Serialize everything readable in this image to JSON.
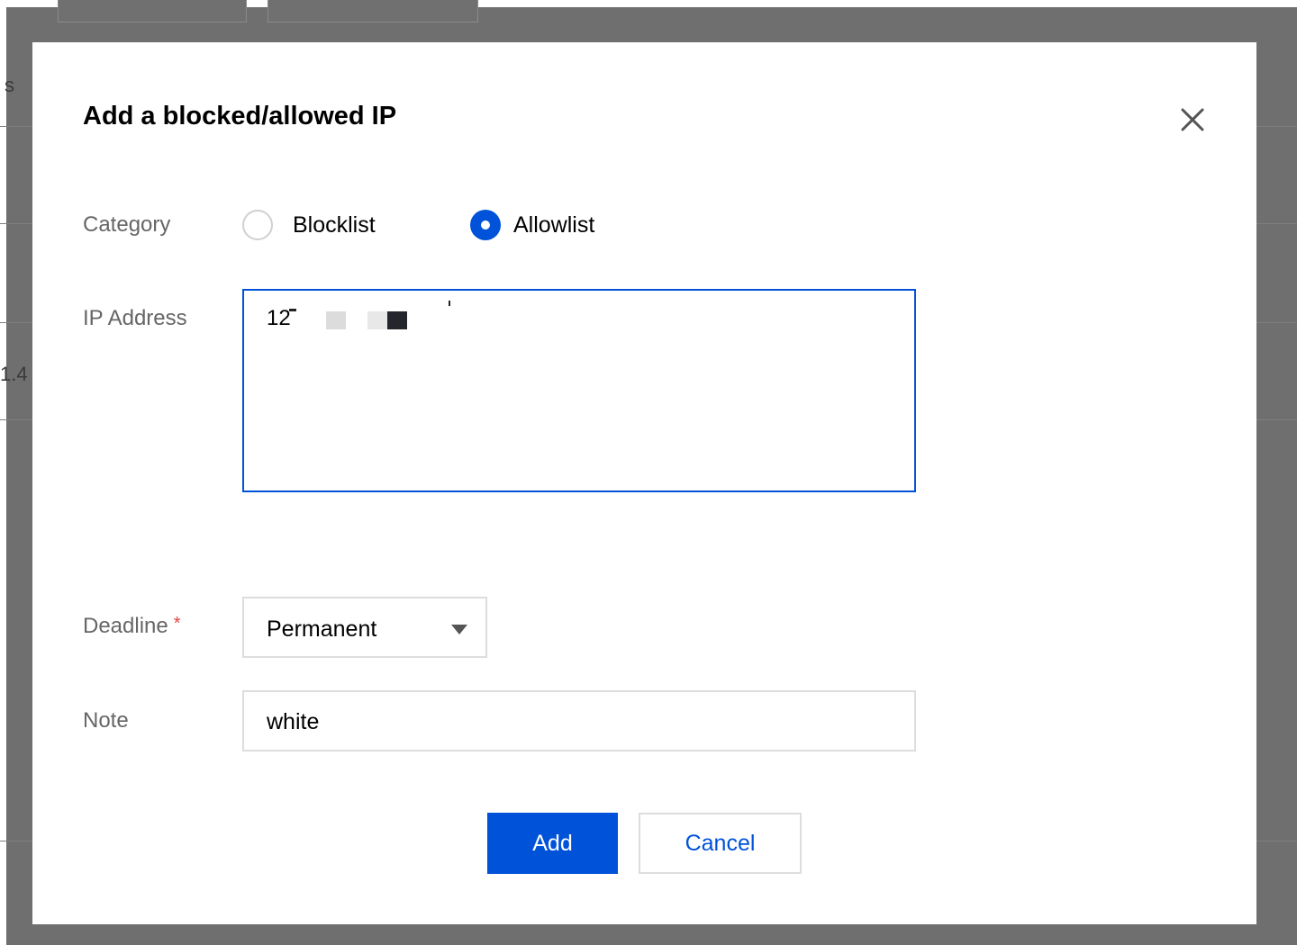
{
  "background": {
    "partial_texts": [
      "s",
      "1.4"
    ]
  },
  "modal": {
    "title": "Add a blocked/allowed IP",
    "close_icon": "close-icon"
  },
  "form": {
    "category": {
      "label": "Category",
      "options": [
        "Blocklist",
        "Allowlist"
      ],
      "selected": "Allowlist"
    },
    "ip_address": {
      "label": "IP Address",
      "value_visible": "12"
    },
    "deadline": {
      "label": "Deadline",
      "required_mark": "*",
      "value": "Permanent",
      "caret_icon": "caret-down-icon"
    },
    "note": {
      "label": "Note",
      "value": "white"
    }
  },
  "actions": {
    "add_label": "Add",
    "cancel_label": "Cancel"
  },
  "colors": {
    "primary": "#0052d9",
    "overlay": "#6f6f6f",
    "required": "#e54545",
    "label": "#666666"
  }
}
